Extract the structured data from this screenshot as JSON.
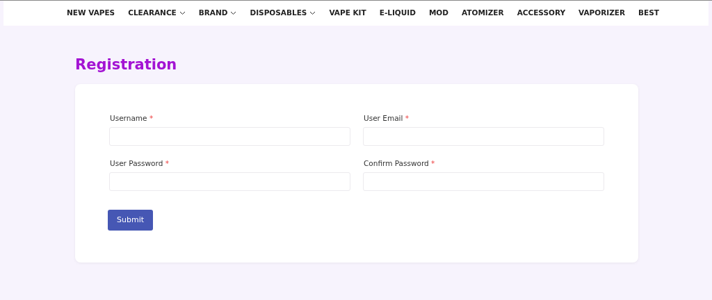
{
  "nav": [
    {
      "label": "NEW VAPES",
      "dropdown": false
    },
    {
      "label": "CLEARANCE",
      "dropdown": true
    },
    {
      "label": "BRAND",
      "dropdown": true
    },
    {
      "label": "DISPOSABLES",
      "dropdown": true
    },
    {
      "label": "VAPE KIT",
      "dropdown": false
    },
    {
      "label": "E-LIQUID",
      "dropdown": false
    },
    {
      "label": "MOD",
      "dropdown": false
    },
    {
      "label": "ATOMIZER",
      "dropdown": false
    },
    {
      "label": "ACCESSORY",
      "dropdown": false
    },
    {
      "label": "VAPORIZER",
      "dropdown": false
    },
    {
      "label": "BEST",
      "dropdown": false
    }
  ],
  "title": "Registration",
  "fields": [
    {
      "label": "Username",
      "required_mark": "*"
    },
    {
      "label": "User Email",
      "required_mark": "*"
    },
    {
      "label": "User Password",
      "required_mark": "*"
    },
    {
      "label": "Confirm Password",
      "required_mark": "*"
    }
  ],
  "submit": "Submit"
}
